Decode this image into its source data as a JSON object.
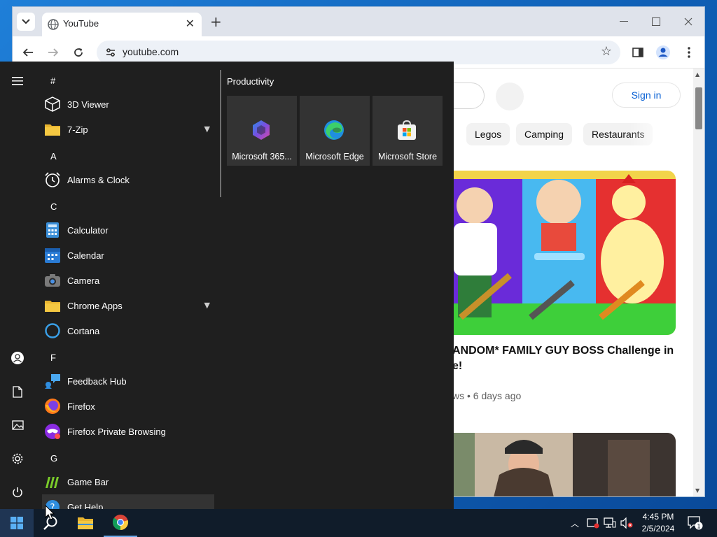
{
  "browser": {
    "tab_title": "YouTube",
    "url": "youtube.com",
    "close_tab": "✕",
    "new_tab": "+"
  },
  "youtube": {
    "sign_in": "Sign in",
    "chips": [
      "Legos",
      "Camping",
      "Restaurants"
    ],
    "video_title": "ANDOM* FAMILY GUY BOSS Challenge in e!",
    "video_meta": "ws • 6 days ago"
  },
  "start_menu": {
    "letters": [
      "#",
      "A",
      "C",
      "F",
      "G"
    ],
    "apps": [
      {
        "label": "3D Viewer",
        "icon": "cube-icon"
      },
      {
        "label": "7-Zip",
        "icon": "folder-icon"
      },
      {
        "label": "Alarms & Clock",
        "icon": "alarm-clock-icon"
      },
      {
        "label": "Calculator",
        "icon": "calculator-icon"
      },
      {
        "label": "Calendar",
        "icon": "calendar-icon"
      },
      {
        "label": "Camera",
        "icon": "camera-icon"
      },
      {
        "label": "Chrome Apps",
        "icon": "folder-icon"
      },
      {
        "label": "Cortana",
        "icon": "cortana-icon"
      },
      {
        "label": "Feedback Hub",
        "icon": "feedback-hub-icon"
      },
      {
        "label": "Firefox",
        "icon": "firefox-icon"
      },
      {
        "label": "Firefox Private Browsing",
        "icon": "firefox-private-icon"
      },
      {
        "label": "Game Bar",
        "icon": "game-bar-icon"
      },
      {
        "label": "Get Help",
        "icon": "get-help-icon"
      }
    ],
    "productivity_title": "Productivity",
    "tiles": [
      {
        "label": "Microsoft 365...",
        "icon": "microsoft-365-icon"
      },
      {
        "label": "Microsoft Edge",
        "icon": "edge-icon"
      },
      {
        "label": "Microsoft Store",
        "icon": "store-icon"
      }
    ]
  },
  "taskbar": {
    "time": "4:45 PM",
    "date": "2/5/2024",
    "notification_count": "1"
  },
  "colors": {
    "start_bg": "#1f1f1f",
    "tile_bg": "#333333",
    "taskbar_bg": "#101c2a",
    "youtube_link": "#065fd4"
  }
}
